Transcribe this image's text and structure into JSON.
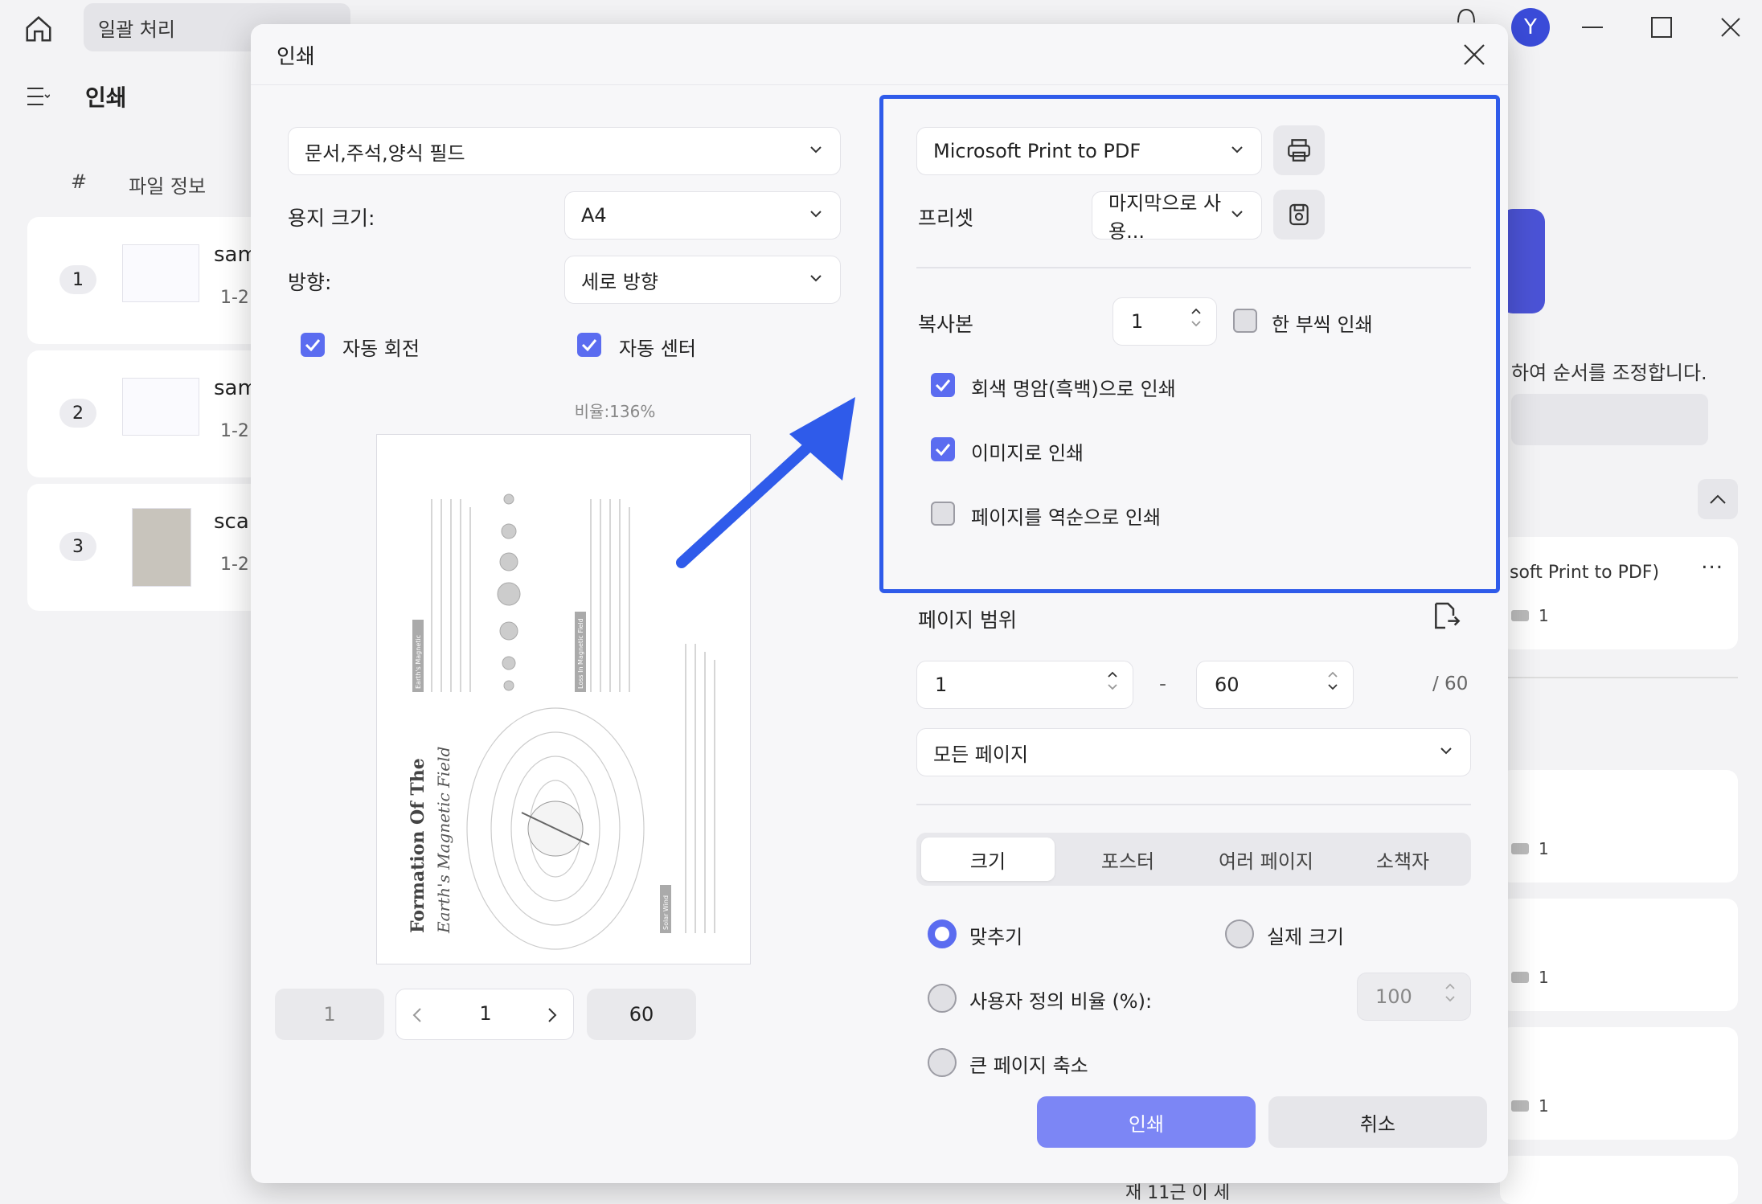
{
  "background": {
    "tab_batch": "일괄 처리",
    "avatar_letter": "Y",
    "page_title": "인쇄",
    "list_headers": [
      "#",
      "파일 정보"
    ],
    "files": [
      {
        "num": "1",
        "name": "sam",
        "range": "1-2"
      },
      {
        "num": "2",
        "name": "sam",
        "range": "1-2"
      },
      {
        "num": "3",
        "name": "scar",
        "range": "1-2"
      }
    ],
    "reorder_hint": "하여 순서를 조정합니다.",
    "task": {
      "printer": "soft Print to PDF)",
      "more": "...",
      "count": "1"
    },
    "task_counts": [
      "1",
      "1",
      "1"
    ],
    "bottom_cut_text": "재 11근 이 세"
  },
  "dialog": {
    "title": "인쇄",
    "content_select": "문서,주석,양식 필드",
    "paper_size_label": "용지 크기:",
    "paper_size": "A4",
    "orientation_label": "방향:",
    "orientation": "세로 방향",
    "auto_rotate": "자동 회전",
    "auto_center": "자동 센터",
    "ratio": "비율:136%",
    "preview_page": {
      "title": "Formation Of The",
      "subtitle": "Earth's Magnetic Field",
      "tag_left": "Earth's Magnetic",
      "tag_mid": "Loss In Magnetic Field",
      "tag_bottom": "Solar Wind"
    },
    "pager": {
      "first": "1",
      "current": "1",
      "last": "60"
    },
    "printer": "Microsoft Print to PDF",
    "preset_label": "프리셋",
    "preset_value": "마지막으로 사용...",
    "copies_label": "복사본",
    "copies_value": "1",
    "collate": "한 부씩 인쇄",
    "grayscale": "회색 명암(흑백)으로 인쇄",
    "as_image": "이미지로 인쇄",
    "reverse": "페이지를 역순으로 인쇄",
    "page_range_label": "페이지 범위",
    "range_from": "1",
    "range_dash": "-",
    "range_to": "60",
    "range_total": "/ 60",
    "range_mode": "모든 페이지",
    "tabs": [
      "크기",
      "포스터",
      "여러 페이지",
      "소책자"
    ],
    "fit": "맞추기",
    "actual_size": "실제 크기",
    "custom_scale": "사용자 정의 비율 (%):",
    "custom_scale_value": "100",
    "shrink": "큰 페이지 축소",
    "print_button": "인쇄",
    "cancel_button": "취소",
    "accent_color": "#5b6cf0",
    "highlight_color": "#2f5bea"
  }
}
